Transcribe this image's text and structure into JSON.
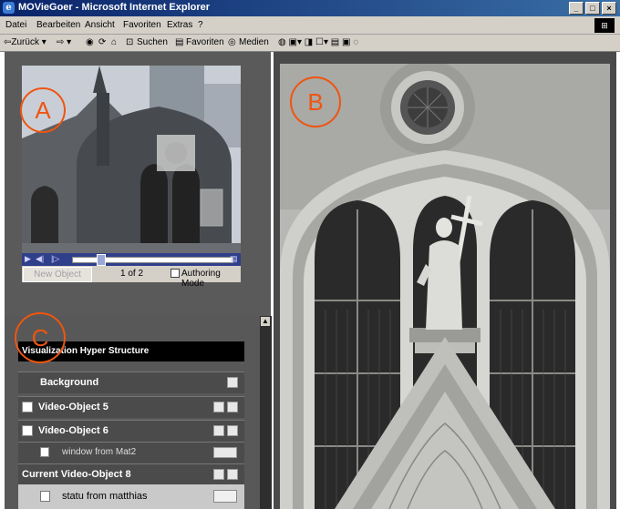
{
  "window": {
    "title": "MOVieGoer - Microsoft Internet Explorer",
    "min_label": "_",
    "max_label": "□",
    "close_label": "×"
  },
  "menu": [
    "Datei",
    "Bearbeiten",
    "Ansicht",
    "Favoriten",
    "Extras",
    "?"
  ],
  "toolbar": {
    "back": "⇦Zurück ▾",
    "forward": "⇨ ▾",
    "search": "Suchen",
    "favorites": "Favoriten",
    "media": "Medien",
    "tail": "◍ ▣▾ ◨ ☐▾ ▤ ▣ ◌"
  },
  "video": {
    "new_object": "New Object",
    "counter": "1 of 2",
    "authoring_mode": "Authoring Mode"
  },
  "annotations": {
    "a": "A",
    "b": "B",
    "c": "C"
  },
  "hyper": {
    "title": "Visualization Hyper Structure",
    "background": "Background",
    "vo5": "Video-Object 5",
    "vo6": "Video-Object 6",
    "sub1": "window from Mat2",
    "current": "Current Video-Object 8",
    "sub2": "statu from matthias"
  }
}
